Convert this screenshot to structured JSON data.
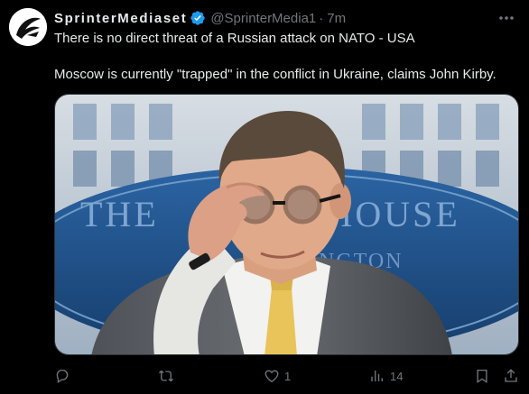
{
  "post": {
    "display_name": "SprinterMediaset",
    "verified": true,
    "handle": "@SprinterMedia1",
    "separator": "·",
    "time": "7m",
    "text_line1": "There is no direct threat of a Russian attack on NATO - USA",
    "text_line2": "Moscow is currently \"trapped\" in the conflict in Ukraine, claims John Kirby.",
    "image_backdrop_text_top": "THE",
    "image_backdrop_text_right": "E HOUSE",
    "image_backdrop_text_bottom": "NGTON"
  },
  "actions": {
    "reply_icon": "reply-icon",
    "repost_icon": "repost-icon",
    "like_icon": "heart-icon",
    "like_count": "1",
    "views_icon": "views-icon",
    "views_count": "14",
    "bookmark_icon": "bookmark-icon",
    "share_icon": "share-icon"
  },
  "colors": {
    "background": "#000000",
    "text": "#e7e9ea",
    "secondary_text": "#71767b",
    "verified_badge": "#1d9bf0",
    "backdrop_blue": "#1f4f86"
  }
}
